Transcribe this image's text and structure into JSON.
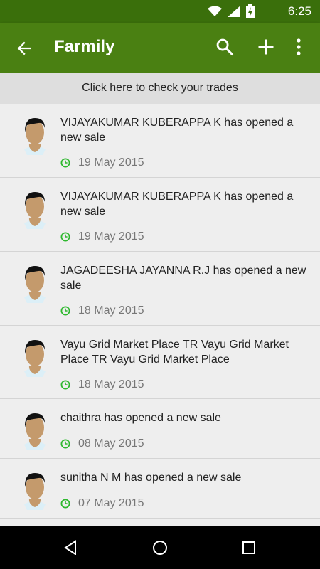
{
  "status_bar": {
    "time": "6:25",
    "icons": [
      "wifi-icon",
      "signal-icon",
      "battery-icon"
    ]
  },
  "app_bar": {
    "title": "Farmily",
    "icons": [
      "back-arrow-icon",
      "search-icon",
      "add-icon",
      "more-vert-icon"
    ]
  },
  "banner": {
    "label": "Click here to check your trades"
  },
  "feed": {
    "items": [
      {
        "text": "VIJAYAKUMAR KUBERAPPA K has opened a new sale",
        "date": "19 May 2015"
      },
      {
        "text": "VIJAYAKUMAR KUBERAPPA K has opened a new sale",
        "date": "19 May 2015"
      },
      {
        "text": "JAGADEESHA JAYANNA R.J has opened a new sale",
        "date": "18 May 2015"
      },
      {
        "text": "Vayu Grid  Market Place  TR Vayu Grid Market Place  TR Vayu Grid  Market Place",
        "date": "18 May 2015"
      },
      {
        "text": "chaithra has opened a new sale",
        "date": "08 May 2015"
      },
      {
        "text": "sunitha N M  has opened a new sale",
        "date": "07 May 2015"
      }
    ]
  },
  "nav_bar": {
    "icons": [
      "back-triangle-icon",
      "home-circle-icon",
      "recents-square-icon"
    ]
  },
  "colors": {
    "app_bar": "#4a8012",
    "status_bar": "#3a6f0b",
    "clock_icon": "#2eb82e"
  }
}
